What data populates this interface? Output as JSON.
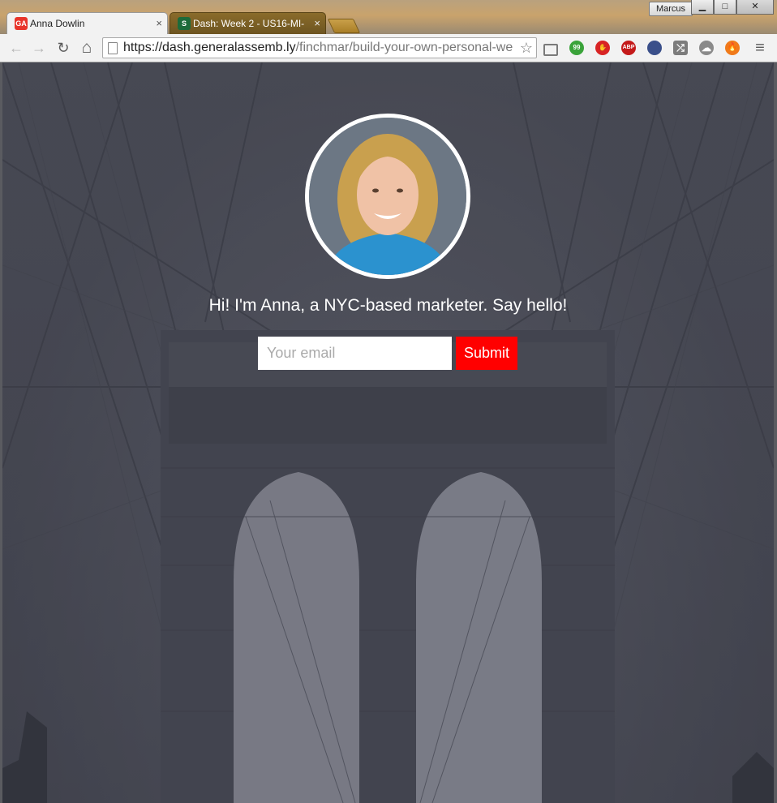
{
  "window": {
    "profile_name": "Marcus",
    "minimize_glyph": "▁",
    "maximize_glyph": "□",
    "close_glyph": "✕"
  },
  "tabs": [
    {
      "title": "Anna Dowlin",
      "favicon_text": "GA",
      "favicon_color": "#e8352b",
      "close_glyph": "×",
      "active": true
    },
    {
      "title": "Dash: Week 2 - US16-MI-",
      "favicon_text": "S",
      "favicon_color": "#1d6b3a",
      "close_glyph": "×",
      "active": false
    }
  ],
  "toolbar": {
    "back_glyph": "←",
    "forward_glyph": "→",
    "reload_glyph": "↻",
    "home_glyph": "⌂",
    "url_host": "https://dash.generalassemb.ly",
    "url_path": "/finchmar/build-your-own-personal-we",
    "star_glyph": "☆",
    "extensions": [
      {
        "name": "cast-icon",
        "color": "#7a7a7a",
        "label": ""
      },
      {
        "name": "quote-icon",
        "color": "#3aa33a",
        "label": "99"
      },
      {
        "name": "stop-hand-icon",
        "color": "#d82424",
        "label": "✋"
      },
      {
        "name": "adblock-plus-icon",
        "color": "#c41a1a",
        "label": "ABP"
      },
      {
        "name": "flag-icon",
        "color": "#3a4f8a",
        "label": ""
      },
      {
        "name": "shuffle-icon",
        "color": "#7c7c7c",
        "label": "⤮"
      },
      {
        "name": "cloud-icon",
        "color": "#8a8a8a",
        "label": "☁"
      },
      {
        "name": "fire-icon",
        "color": "#f07a1a",
        "label": "🔥"
      }
    ],
    "menu_glyph": "≡"
  },
  "hero": {
    "tagline": "Hi! I'm Anna, a NYC-based marketer. Say hello!",
    "email_placeholder": "Your email",
    "email_value": "",
    "submit_label": "Submit",
    "submit_color": "#ff0000"
  }
}
